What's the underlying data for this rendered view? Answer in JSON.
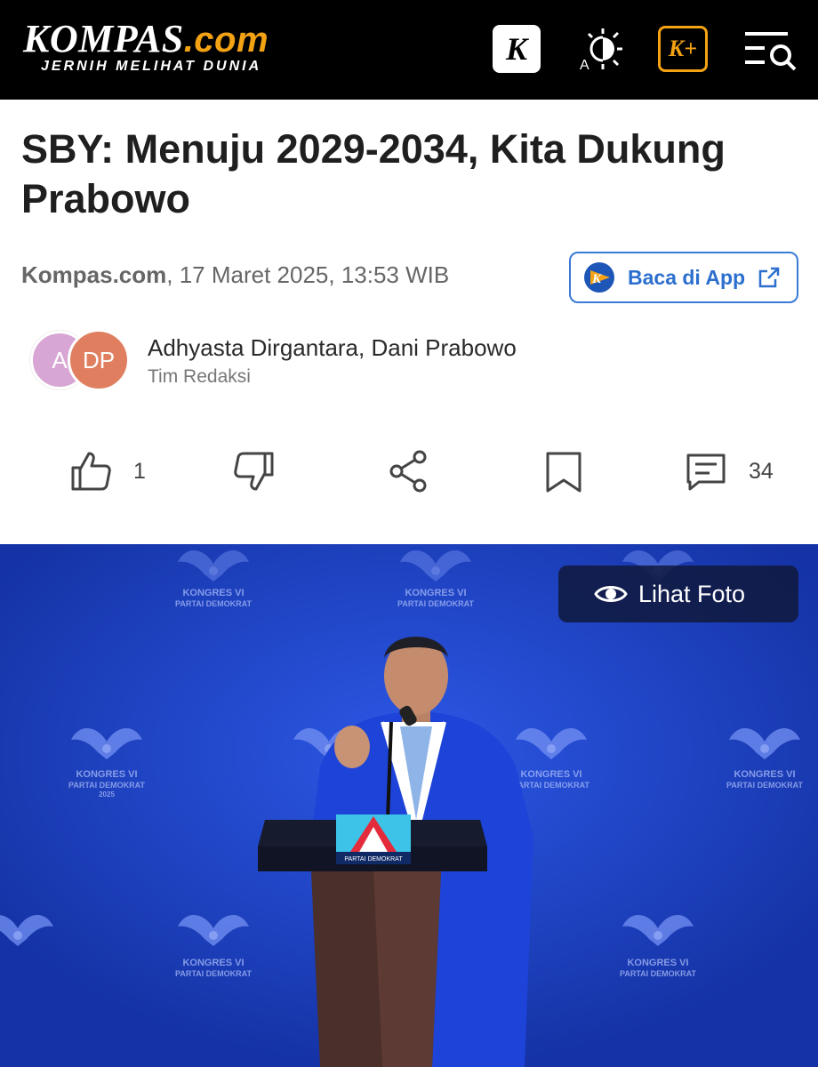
{
  "header": {
    "logo_main": "KOMPAS",
    "logo_domain": ".com",
    "logo_tagline": "JERNIH MELIHAT DUNIA",
    "icons": [
      "kompas-k-icon",
      "theme-toggle-icon",
      "kompas-plus-icon",
      "menu-search-icon"
    ],
    "k_label": "K",
    "kplus_label": "K+"
  },
  "article": {
    "title": "SBY: Menuju 2029-2034, Kita Dukung Prabowo",
    "source": "Kompas.com",
    "date": ", 17 Maret 2025, 13:53 WIB",
    "app_button_label": "Baca di App"
  },
  "authors": {
    "avatar_1": "A",
    "avatar_2": "DP",
    "names": "Adhyasta Dirgantara, Dani Prabowo",
    "role": "Tim Redaksi"
  },
  "actions": {
    "like_count": "1",
    "comment_count": "34"
  },
  "photo": {
    "view_label": "Lihat Foto",
    "backdrop_text_line1": "KONGRES VI",
    "backdrop_text_line2": "PARTAI DEMOKRAT",
    "backdrop_text_line3": "2025",
    "podium_label": "PARTAI DEMOKRAT"
  },
  "colors": {
    "brand_orange": "#f3a213",
    "link_blue": "#2c6fce",
    "stage_blue": "#1f47d6"
  }
}
